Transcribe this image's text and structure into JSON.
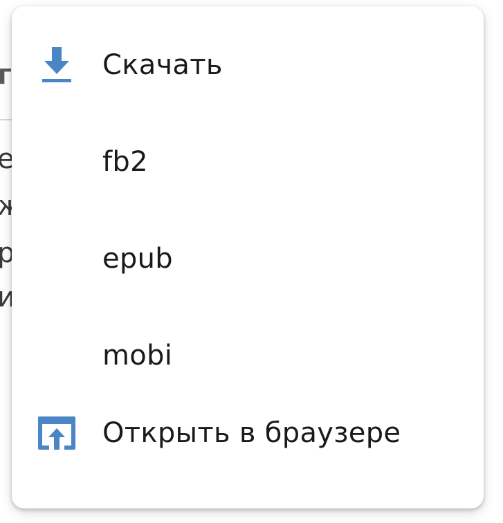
{
  "background": {
    "title_fragment": "г",
    "line_fragments": [
      "е",
      "ж",
      "р",
      "и"
    ]
  },
  "menu": {
    "items": [
      {
        "label": "Скачать",
        "icon": "download-icon"
      },
      {
        "label": "fb2",
        "icon": null
      },
      {
        "label": "epub",
        "icon": null
      },
      {
        "label": "mobi",
        "icon": null
      },
      {
        "label": "Открыть в браузере",
        "icon": "open-in-browser-icon"
      }
    ]
  },
  "colors": {
    "icon_accent": "#4a86c5",
    "text": "#1a1a1a"
  }
}
